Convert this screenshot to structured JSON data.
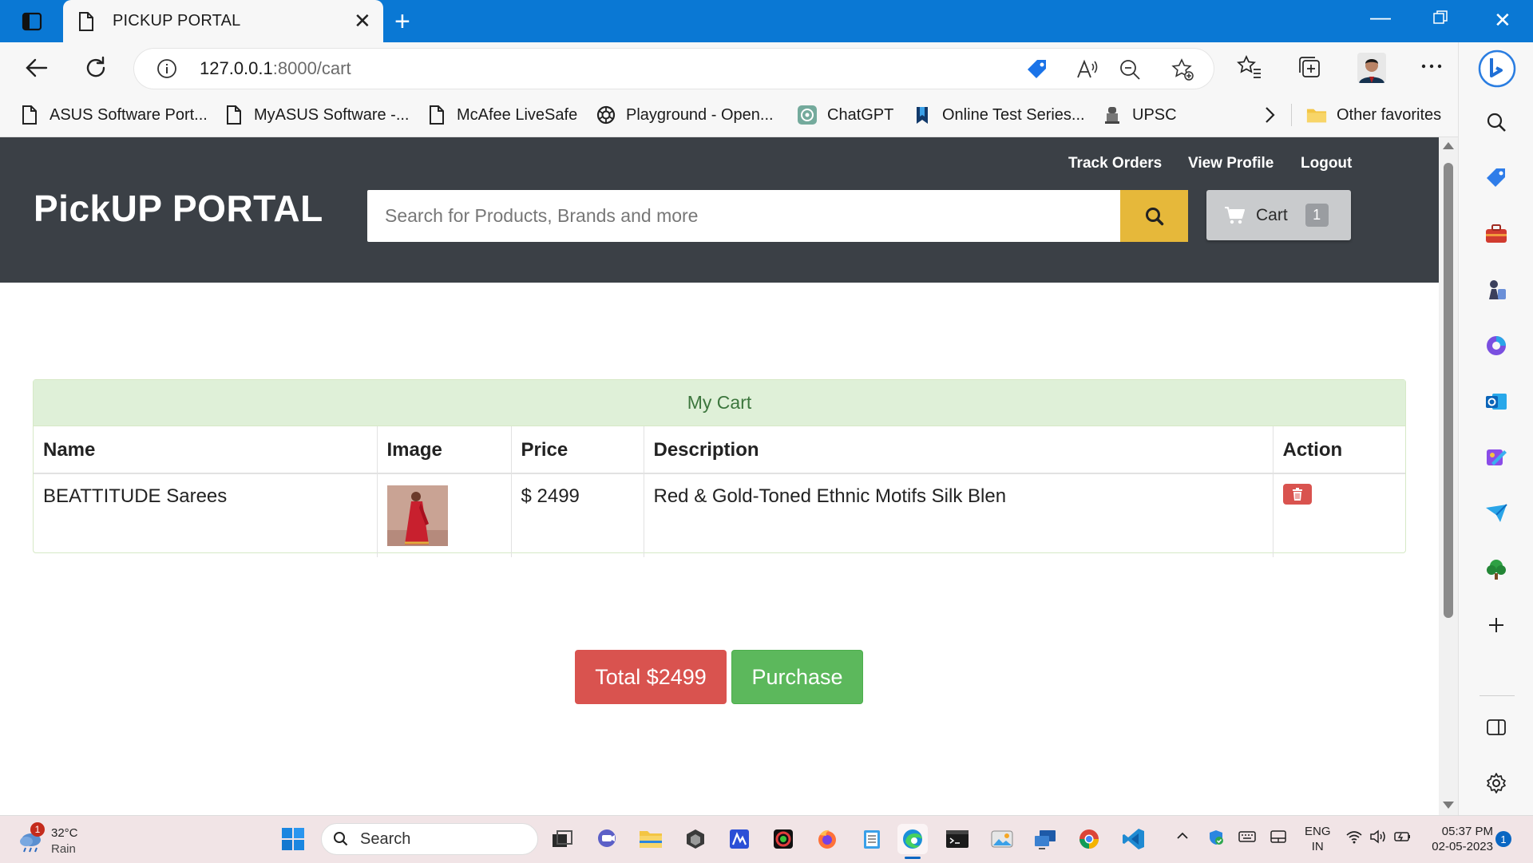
{
  "browser": {
    "tab_title": "PICKUP PORTAL",
    "url_host": "127.0.0.1",
    "url_rest": ":8000/cart",
    "favorites": [
      {
        "label": "ASUS Software Port...",
        "icon": "page-icon"
      },
      {
        "label": "MyASUS Software -...",
        "icon": "page-icon"
      },
      {
        "label": "McAfee LiveSafe",
        "icon": "page-icon"
      },
      {
        "label": "Playground - Open...",
        "icon": "openai-icon"
      },
      {
        "label": "ChatGPT",
        "icon": "chatgpt-icon"
      },
      {
        "label": "Online Test Series...",
        "icon": "bookmark-icon"
      },
      {
        "label": "UPSC",
        "icon": "emblem-icon"
      }
    ],
    "other_favorites": "Other favorites"
  },
  "site": {
    "brand": "PickUP PORTAL",
    "nav": {
      "track_orders": "Track Orders",
      "view_profile": "View Profile",
      "logout": "Logout"
    },
    "search_placeholder": "Search for Products, Brands and more",
    "cart_label": "Cart",
    "cart_count": "1"
  },
  "cart": {
    "heading": "My Cart",
    "columns": [
      "Name",
      "Image",
      "Price",
      "Description",
      "Action"
    ],
    "rows": [
      {
        "name": "BEATTITUDE Sarees",
        "price": "$ 2499",
        "description": "Red & Gold-Toned Ethnic Motifs Silk Blen"
      }
    ],
    "total": "Total $2499",
    "purchase": "Purchase"
  },
  "taskbar": {
    "weather_temp": "32°C",
    "weather_desc": "Rain",
    "weather_badge": "1",
    "search_label": "Search",
    "lang_top": "ENG",
    "lang_bottom": "IN",
    "time": "05:37 PM",
    "date": "02-05-2023",
    "notifications": "1"
  },
  "colors": {
    "titlebar": "#0a78d4",
    "site_header": "#3b4046",
    "search_button": "#e6b83a",
    "panel_heading_bg": "#dff0d8",
    "panel_heading_text": "#3c763d",
    "danger": "#d9534f",
    "success": "#5cb85c"
  }
}
